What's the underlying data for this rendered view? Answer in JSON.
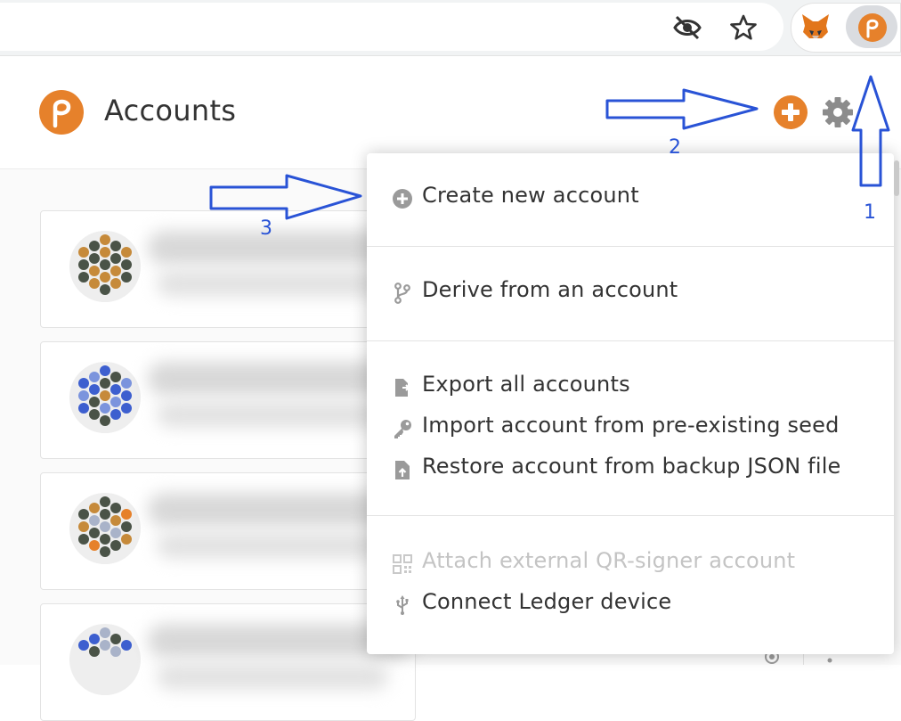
{
  "header": {
    "title": "Accounts"
  },
  "browser": {
    "icons": [
      "eye-off-icon",
      "star-icon",
      "metamask-fox-icon",
      "polkadot-extension-icon"
    ]
  },
  "menu": {
    "sections": [
      {
        "items": [
          {
            "label": "Create new account",
            "icon": "plus-circle-icon"
          }
        ]
      },
      {
        "items": [
          {
            "label": "Derive from an account",
            "icon": "code-branch-icon"
          }
        ]
      },
      {
        "items": [
          {
            "label": "Export all accounts",
            "icon": "file-export-icon"
          },
          {
            "label": "Import account from pre-existing seed",
            "icon": "key-icon"
          },
          {
            "label": "Restore account from backup JSON file",
            "icon": "file-upload-icon"
          }
        ]
      },
      {
        "items": [
          {
            "label": "Attach external QR-signer account",
            "icon": "qrcode-icon",
            "disabled": true
          },
          {
            "label": "Connect Ledger device",
            "icon": "usb-icon"
          }
        ]
      }
    ]
  },
  "annotations": {
    "step1": "1",
    "step2": "2",
    "step3": "3",
    "arrow_color": "#2953d6"
  },
  "colors": {
    "brand": "#e6812b",
    "text": "#333333",
    "disabled_text": "#c4c4c4"
  }
}
